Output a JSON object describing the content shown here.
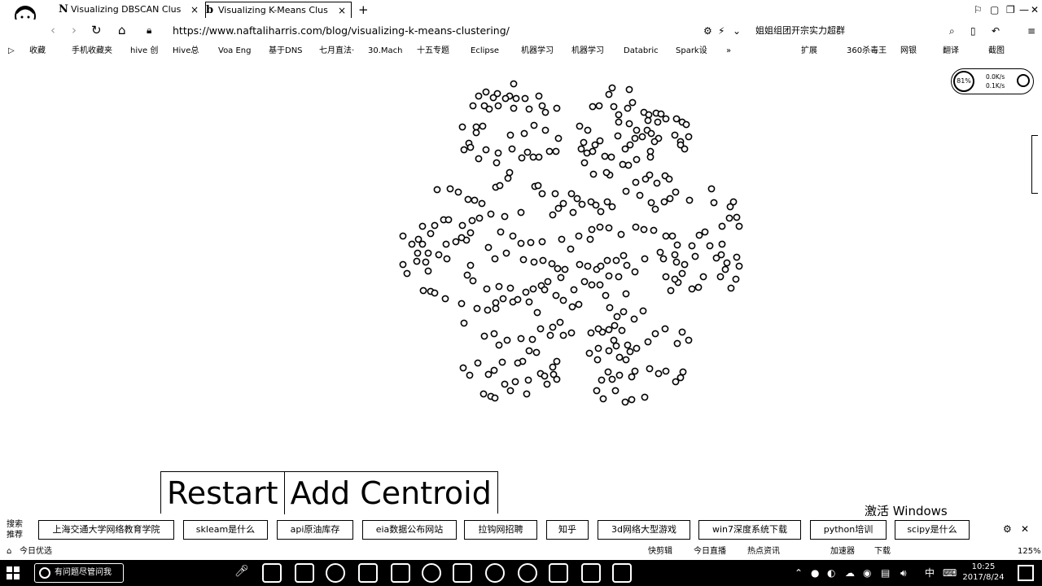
{
  "browser": {
    "tabs": [
      {
        "favicon": "N",
        "title": "Visualizing DBSCAN Clusteri",
        "close": "×",
        "active": false
      },
      {
        "favicon": "b",
        "title": "Visualizing K-Means Clustering",
        "close": "×",
        "active": true
      }
    ],
    "new_tab": "+",
    "window_controls": [
      "⚐",
      "▢",
      "❐",
      "—",
      "✕"
    ],
    "url": "https://www.naftaliharris.com/blog/visualizing-k-means-clustering/",
    "search_hint": "姐姐组团开宗实力超群",
    "bookmarks": [
      "收藏",
      "手机收藏夹",
      "hive 创",
      "Hive总",
      "Voa Eng",
      "基于DNS",
      "七月直法·",
      "30.Mach",
      "十五专题",
      "Eclipse",
      "机器学习",
      "机器学习",
      "Databric",
      "Spark设",
      "»"
    ],
    "bookmarks_right": [
      "扩展",
      "360杀毒王",
      "网银",
      "翻译",
      "截图"
    ]
  },
  "netmeter": {
    "badge": "81%",
    "down": "0.0K/s",
    "up": "0.1K/s"
  },
  "controls": {
    "restart": "Restart",
    "add_centroid": "Add Centroid"
  },
  "activation": "激活 Windows",
  "search_bar": {
    "label": "搜索\n推荐",
    "chips": [
      "上海交通大学网络教育学院",
      "skleam是什么",
      "api原油库存",
      "eia数据公布网站",
      "拉钩网招聘",
      "知乎",
      "3d网络大型游戏",
      "win7深度系统下载",
      "python培训",
      "scipy是什么"
    ]
  },
  "status_bar": {
    "left": "今日优选",
    "items": [
      "快剪辑",
      "今日直播",
      "热点资讯",
      "加速器",
      "下载"
    ],
    "zoom": "125%"
  },
  "taskbar": {
    "search_text": "有问题尽管问我",
    "ime": "中",
    "time": "10:25",
    "date": "2017/8/24"
  },
  "chart_data": {
    "type": "scatter",
    "title": "",
    "xlabel": "",
    "ylabel": "",
    "points": [
      [
        631,
        103
      ],
      [
        597,
        113
      ],
      [
        611,
        115
      ],
      [
        588,
        118
      ],
      [
        626,
        118
      ],
      [
        606,
        120
      ],
      [
        621,
        121
      ],
      [
        634,
        121
      ],
      [
        645,
        121
      ],
      [
        662,
        118
      ],
      [
        581,
        130
      ],
      [
        595,
        130
      ],
      [
        601,
        134
      ],
      [
        612,
        130
      ],
      [
        631,
        133
      ],
      [
        650,
        134
      ],
      [
        666,
        130
      ],
      [
        684,
        133
      ],
      [
        670,
        138
      ],
      [
        752,
        108
      ],
      [
        748,
        116
      ],
      [
        773,
        110
      ],
      [
        777,
        126
      ],
      [
        771,
        133
      ],
      [
        728,
        131
      ],
      [
        736,
        130
      ],
      [
        754,
        131
      ],
      [
        760,
        141
      ],
      [
        760,
        150
      ],
      [
        773,
        152
      ],
      [
        791,
        138
      ],
      [
        797,
        141
      ],
      [
        806,
        139
      ],
      [
        796,
        148
      ],
      [
        812,
        140
      ],
      [
        808,
        150
      ],
      [
        818,
        146
      ],
      [
        831,
        146
      ],
      [
        838,
        150
      ],
      [
        843,
        153
      ],
      [
        568,
        156
      ],
      [
        585,
        156
      ],
      [
        593,
        155
      ],
      [
        585,
        163
      ],
      [
        576,
        176
      ],
      [
        578,
        181
      ],
      [
        570,
        184
      ],
      [
        588,
        195
      ],
      [
        597,
        184
      ],
      [
        612,
        188
      ],
      [
        629,
        183
      ],
      [
        627,
        166
      ],
      [
        644,
        164
      ],
      [
        656,
        154
      ],
      [
        670,
        160
      ],
      [
        686,
        170
      ],
      [
        675,
        186
      ],
      [
        683,
        186
      ],
      [
        662,
        193
      ],
      [
        655,
        193
      ],
      [
        641,
        194
      ],
      [
        648,
        187
      ],
      [
        712,
        155
      ],
      [
        722,
        160
      ],
      [
        717,
        175
      ],
      [
        714,
        183
      ],
      [
        721,
        188
      ],
      [
        731,
        178
      ],
      [
        737,
        173
      ],
      [
        728,
        186
      ],
      [
        743,
        192
      ],
      [
        751,
        193
      ],
      [
        759,
        167
      ],
      [
        768,
        183
      ],
      [
        774,
        178
      ],
      [
        780,
        170
      ],
      [
        789,
        168
      ],
      [
        782,
        160
      ],
      [
        795,
        160
      ],
      [
        800,
        164
      ],
      [
        809,
        170
      ],
      [
        804,
        174
      ],
      [
        829,
        166
      ],
      [
        836,
        174
      ],
      [
        846,
        168
      ],
      [
        836,
        178
      ],
      [
        841,
        183
      ],
      [
        799,
        186
      ],
      [
        799,
        193
      ],
      [
        782,
        196
      ],
      [
        610,
        200
      ],
      [
        626,
        212
      ],
      [
        624,
        219
      ],
      [
        609,
        230
      ],
      [
        614,
        228
      ],
      [
        592,
        250
      ],
      [
        583,
        246
      ],
      [
        603,
        263
      ],
      [
        620,
        266
      ],
      [
        640,
        261
      ],
      [
        657,
        229
      ],
      [
        661,
        228
      ],
      [
        666,
        238
      ],
      [
        682,
        238
      ],
      [
        686,
        256
      ],
      [
        679,
        264
      ],
      [
        692,
        250
      ],
      [
        702,
        238
      ],
      [
        709,
        244
      ],
      [
        704,
        261
      ],
      [
        715,
        251
      ],
      [
        726,
        248
      ],
      [
        732,
        252
      ],
      [
        746,
        248
      ],
      [
        752,
        254
      ],
      [
        738,
        260
      ],
      [
        718,
        200
      ],
      [
        729,
        214
      ],
      [
        749,
        215
      ],
      [
        745,
        212
      ],
      [
        765,
        202
      ],
      [
        772,
        203
      ],
      [
        793,
        220
      ],
      [
        798,
        215
      ],
      [
        807,
        225
      ],
      [
        817,
        216
      ],
      [
        822,
        220
      ],
      [
        769,
        235
      ],
      [
        781,
        224
      ],
      [
        786,
        240
      ],
      [
        800,
        249
      ],
      [
        805,
        257
      ],
      [
        816,
        248
      ],
      [
        823,
        244
      ],
      [
        830,
        236
      ],
      [
        847,
        246
      ],
      [
        537,
        233
      ],
      [
        553,
        232
      ],
      [
        563,
        236
      ],
      [
        575,
        245
      ],
      [
        589,
        268
      ],
      [
        519,
        278
      ],
      [
        534,
        277
      ],
      [
        545,
        270
      ],
      [
        551,
        270
      ],
      [
        568,
        277
      ],
      [
        580,
        271
      ],
      [
        578,
        286
      ],
      [
        573,
        295
      ],
      [
        567,
        292
      ],
      [
        560,
        297
      ],
      [
        548,
        300
      ],
      [
        529,
        287
      ],
      [
        514,
        294
      ],
      [
        495,
        290
      ],
      [
        506,
        300
      ],
      [
        519,
        300
      ],
      [
        513,
        311
      ],
      [
        526,
        311
      ],
      [
        539,
        313
      ],
      [
        549,
        318
      ],
      [
        495,
        325
      ],
      [
        512,
        321
      ],
      [
        523,
        322
      ],
      [
        500,
        336
      ],
      [
        526,
        333
      ],
      [
        874,
        232
      ],
      [
        877,
        249
      ],
      [
        901,
        248
      ],
      [
        897,
        254
      ],
      [
        896,
        268
      ],
      [
        905,
        267
      ],
      [
        908,
        278
      ],
      [
        887,
        278
      ],
      [
        866,
        285
      ],
      [
        859,
        289
      ],
      [
        850,
        302
      ],
      [
        854,
        315
      ],
      [
        872,
        302
      ],
      [
        887,
        300
      ],
      [
        886,
        313
      ],
      [
        880,
        317
      ],
      [
        893,
        323
      ],
      [
        905,
        316
      ],
      [
        908,
        327
      ],
      [
        891,
        331
      ],
      [
        885,
        340
      ],
      [
        904,
        343
      ],
      [
        898,
        354
      ],
      [
        864,
        340
      ],
      [
        858,
        353
      ],
      [
        850,
        355
      ],
      [
        833,
        347
      ],
      [
        829,
        343
      ],
      [
        818,
        340
      ],
      [
        824,
        357
      ],
      [
        615,
        285
      ],
      [
        630,
        290
      ],
      [
        640,
        299
      ],
      [
        652,
        298
      ],
      [
        666,
        297
      ],
      [
        690,
        294
      ],
      [
        701,
        306
      ],
      [
        711,
        290
      ],
      [
        725,
        294
      ],
      [
        727,
        282
      ],
      [
        737,
        279
      ],
      [
        748,
        280
      ],
      [
        763,
        288
      ],
      [
        781,
        279
      ],
      [
        791,
        282
      ],
      [
        803,
        283
      ],
      [
        818,
        290
      ],
      [
        826,
        290
      ],
      [
        832,
        301
      ],
      [
        811,
        310
      ],
      [
        815,
        318
      ],
      [
        829,
        313
      ],
      [
        831,
        322
      ],
      [
        841,
        325
      ],
      [
        838,
        336
      ],
      [
        608,
        318
      ],
      [
        622,
        311
      ],
      [
        643,
        319
      ],
      [
        656,
        322
      ],
      [
        667,
        320
      ],
      [
        678,
        324
      ],
      [
        685,
        330
      ],
      [
        694,
        331
      ],
      [
        689,
        341
      ],
      [
        673,
        346
      ],
      [
        665,
        351
      ],
      [
        669,
        356
      ],
      [
        646,
        359
      ],
      [
        655,
        355
      ],
      [
        627,
        354
      ],
      [
        613,
        352
      ],
      [
        598,
        355
      ],
      [
        581,
        345
      ],
      [
        574,
        338
      ],
      [
        578,
        326
      ],
      [
        600,
        304
      ],
      [
        712,
        325
      ],
      [
        722,
        327
      ],
      [
        733,
        331
      ],
      [
        738,
        327
      ],
      [
        746,
        320
      ],
      [
        757,
        320
      ],
      [
        766,
        314
      ],
      [
        770,
        326
      ],
      [
        780,
        334
      ],
      [
        792,
        318
      ],
      [
        760,
        340
      ],
      [
        748,
        339
      ],
      [
        737,
        350
      ],
      [
        727,
        350
      ],
      [
        718,
        346
      ],
      [
        705,
        356
      ],
      [
        744,
        363
      ],
      [
        769,
        361
      ],
      [
        520,
        357
      ],
      [
        529,
        358
      ],
      [
        534,
        360
      ],
      [
        547,
        367
      ],
      [
        567,
        373
      ],
      [
        586,
        379
      ],
      [
        599,
        381
      ],
      [
        609,
        379
      ],
      [
        609,
        372
      ],
      [
        618,
        367
      ],
      [
        630,
        371
      ],
      [
        636,
        368
      ],
      [
        650,
        371
      ],
      [
        660,
        384
      ],
      [
        683,
        363
      ],
      [
        692,
        369
      ],
      [
        703,
        377
      ],
      [
        711,
        374
      ],
      [
        749,
        378
      ],
      [
        758,
        389
      ],
      [
        766,
        383
      ],
      [
        779,
        392
      ],
      [
        790,
        382
      ],
      [
        755,
        400
      ],
      [
        740,
        408
      ],
      [
        570,
        397
      ],
      [
        595,
        413
      ],
      [
        607,
        410
      ],
      [
        613,
        424
      ],
      [
        623,
        418
      ],
      [
        640,
        416
      ],
      [
        654,
        417
      ],
      [
        664,
        404
      ],
      [
        679,
        402
      ],
      [
        688,
        396
      ],
      [
        676,
        412
      ],
      [
        692,
        412
      ],
      [
        702,
        409
      ],
      [
        726,
        409
      ],
      [
        735,
        404
      ],
      [
        748,
        405
      ],
      [
        764,
        406
      ],
      [
        754,
        418
      ],
      [
        757,
        425
      ],
      [
        748,
        431
      ],
      [
        735,
        428
      ],
      [
        724,
        434
      ],
      [
        734,
        442
      ],
      [
        761,
        439
      ],
      [
        769,
        442
      ],
      [
        774,
        432
      ],
      [
        782,
        428
      ],
      [
        771,
        424
      ],
      [
        796,
        420
      ],
      [
        805,
        410
      ],
      [
        817,
        404
      ],
      [
        838,
        408
      ],
      [
        846,
        418
      ],
      [
        832,
        422
      ],
      [
        650,
        431
      ],
      [
        659,
        433
      ],
      [
        642,
        444
      ],
      [
        636,
        446
      ],
      [
        617,
        445
      ],
      [
        607,
        455
      ],
      [
        600,
        460
      ],
      [
        587,
        446
      ],
      [
        569,
        452
      ],
      [
        577,
        461
      ],
      [
        620,
        472
      ],
      [
        633,
        469
      ],
      [
        649,
        467
      ],
      [
        664,
        459
      ],
      [
        669,
        462
      ],
      [
        672,
        472
      ],
      [
        680,
        460
      ],
      [
        684,
        466
      ],
      [
        679,
        451
      ],
      [
        684,
        444
      ],
      [
        747,
        457
      ],
      [
        752,
        466
      ],
      [
        739,
        467
      ],
      [
        733,
        480
      ],
      [
        756,
        480
      ],
      [
        761,
        461
      ],
      [
        776,
        463
      ],
      [
        780,
        456
      ],
      [
        798,
        453
      ],
      [
        809,
        459
      ],
      [
        818,
        456
      ],
      [
        830,
        469
      ],
      [
        836,
        464
      ],
      [
        839,
        457
      ],
      [
        594,
        484
      ],
      [
        603,
        487
      ],
      [
        608,
        489
      ],
      [
        627,
        480
      ],
      [
        647,
        484
      ],
      [
        741,
        490
      ],
      [
        768,
        494
      ],
      [
        776,
        491
      ],
      [
        792,
        488
      ]
    ]
  }
}
